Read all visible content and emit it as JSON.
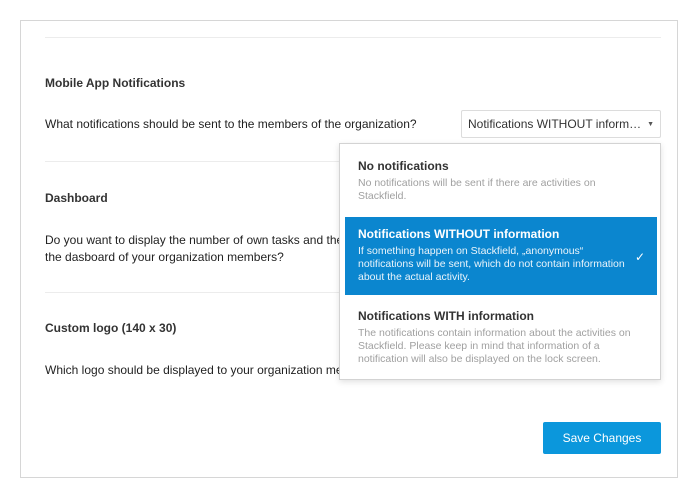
{
  "sections": {
    "mobile": {
      "heading": "Mobile App Notifications",
      "question": "What notifications should be sent to the members of the organization?",
      "select_value": "Notifications WITHOUT informat…"
    },
    "dashboard": {
      "heading": "Dashboard",
      "question": "Do you want to display the number of own tasks and the tab\nthe dasboard of your organization members?"
    },
    "logo": {
      "heading": "Custom logo (140 x 30)",
      "question": "Which logo should be displayed to your organization memb"
    }
  },
  "dropdown": {
    "options": [
      {
        "title": "No notifications",
        "description": "No notifications will be sent if there are activities on Stackfield."
      },
      {
        "title": "Notifications WITHOUT information",
        "description": "If something happen on Stackfield, „anonymous“ notifications will be sent, which do not contain information about the actual activity.",
        "selected": true
      },
      {
        "title": "Notifications WITH information",
        "description": "The notifications contain information about the activities on Stackfield. Please keep in mind that information of a notification will also be displayed on the lock screen."
      }
    ]
  },
  "save_label": "Save Changes",
  "icons": {
    "caret": "caret-down-icon",
    "check": "check-icon"
  },
  "colors": {
    "accent": "#0b97dc",
    "selected_option": "#0b86cf"
  }
}
